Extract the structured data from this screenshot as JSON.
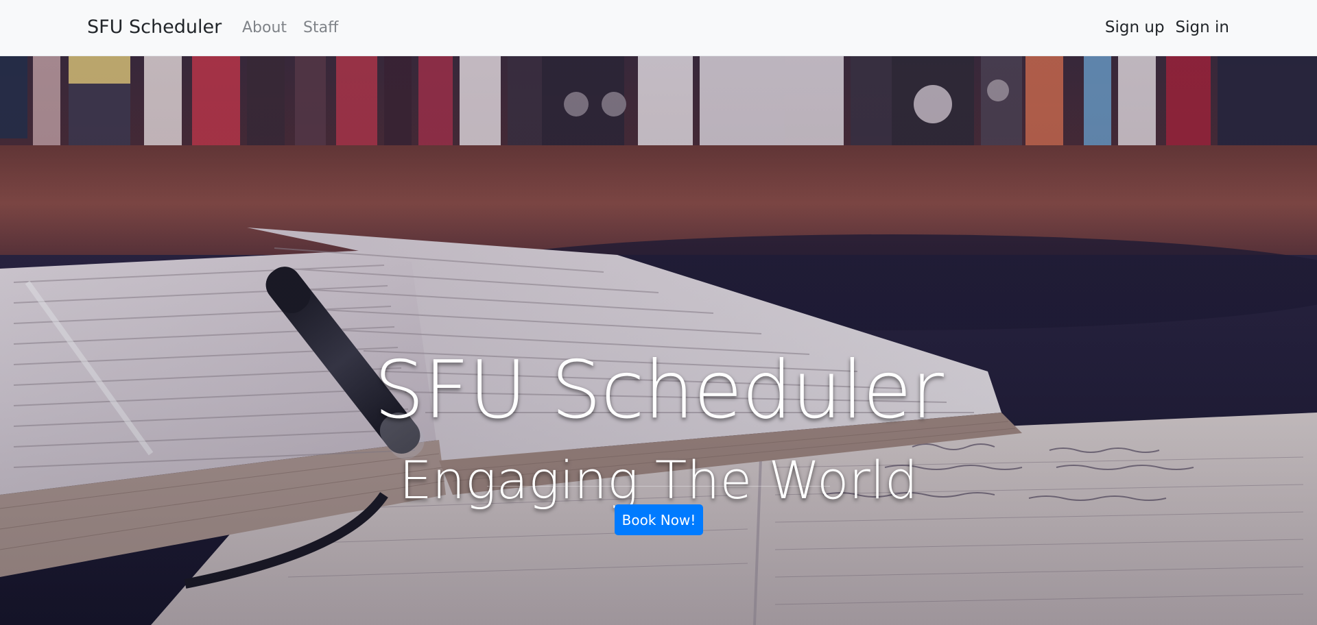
{
  "navbar": {
    "brand": "SFU Scheduler",
    "links": [
      "About",
      "Staff"
    ],
    "auth": {
      "signup": "Sign up",
      "signin": "Sign in"
    }
  },
  "hero": {
    "title": "SFU Scheduler",
    "subtitle": "Engaging The World",
    "cta_label": "Book Now!"
  },
  "colors": {
    "navbar_bg": "#f8f9fa",
    "button_primary": "#007bff",
    "hero_text": "#ffffff"
  }
}
